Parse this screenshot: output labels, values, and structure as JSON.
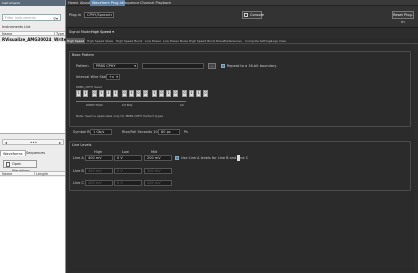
{
  "left_panel": {
    "title": "Instruments",
    "search_placeholder": "Filter Instruments",
    "section_label": "Instruments List",
    "col_name": "Name",
    "col_type": "Type",
    "row_name": "RVisualize_AMG30024",
    "row_type": "Write",
    "tabs": [
      "Waveforms",
      "Sequences"
    ],
    "open_button": "Open Waveform",
    "col2_name": "Name",
    "col2_length": "Length"
  },
  "menubar": [
    "Home",
    "About",
    "Waveform Plug-in",
    "Sequence",
    "Channel Playback"
  ],
  "toolbar": {
    "plugin_label": "Plug-in",
    "plugin_value": "CPHY/Spread",
    "console_label": "Console",
    "reset_label": "Reset Plug-in"
  },
  "mode": {
    "label": "Signal Mode:",
    "value": "High Speed ▾"
  },
  "tabs": [
    "High Speed",
    "High Speed Skew",
    "High Speed Burst",
    "Low Power",
    "Low Power Noise",
    "High Speed Burst Noise",
    "Preferences",
    "Compute Settings",
    "Logs View"
  ],
  "base_pattern": {
    "title": "Base Pattern",
    "pattern_label": "Pattern",
    "pattern_value": "PRBS CPHY",
    "browse_label": "...",
    "repeat_label": "Repeat to a 16-bit boundary",
    "interval_label": "Interval Wire State",
    "interval_value": "+x",
    "prbs_label": "PRBS_CPHY Seed",
    "bits": [
      "1",
      "1",
      "0",
      "1",
      "1",
      "1",
      "0",
      "1",
      "0",
      "0",
      "1",
      "0",
      "1",
      "0",
      "0",
      "1",
      "1",
      "0"
    ],
    "direction_label": "DIRECTION",
    "lsb_label": "bit Bits",
    "msb_label": "b0",
    "note": "Note: Seed is applicable only for PRBS CPHY Perfect types"
  },
  "symbol_rate": {
    "label": "Symbol Rate",
    "value": "1 Gb/s",
    "bw_label": "Rise/Fall Seconds 100%",
    "bw_value": "80 ps",
    "unit": "Ps"
  },
  "line_levels": {
    "title": "Line Levels",
    "col_high": "High",
    "col_low": "Low",
    "col_mid": "Mid",
    "rows": [
      {
        "name": "Line A",
        "high": "400 mV",
        "low": "0 V",
        "mid": "200 mV"
      },
      {
        "name": "Line B",
        "high": "400 mV",
        "low": "0 V",
        "mid": "200 mV"
      },
      {
        "name": "Line C",
        "high": "400 mV",
        "low": "0 V",
        "mid": "200 mV"
      }
    ],
    "same_label": "Use Line A levels for Line B and Line C"
  }
}
